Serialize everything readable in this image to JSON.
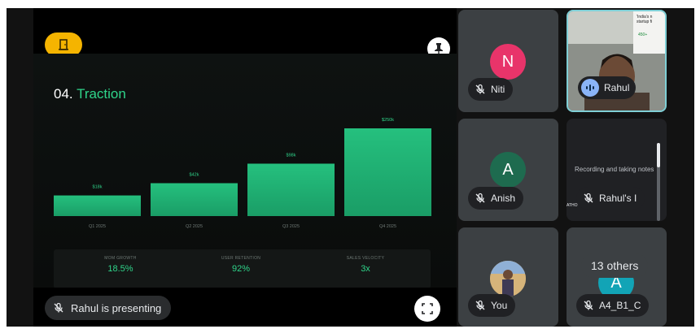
{
  "presentation": {
    "slide": {
      "number": "04.",
      "title": "Traction"
    },
    "presenting_label": "Rahul is presenting",
    "stats": [
      {
        "label": "MOM GROWTH",
        "value": "18.5%"
      },
      {
        "label": "USER RETENTION",
        "value": "92%"
      },
      {
        "label": "SALES VELOCITY",
        "value": "3x"
      }
    ]
  },
  "chart_data": {
    "type": "bar",
    "categories": [
      "Q1 2025",
      "Q2 2025",
      "Q3 2025",
      "Q4 2025"
    ],
    "values": [
      18,
      42,
      98,
      250
    ],
    "value_labels": [
      "$18k",
      "$42k",
      "$98k",
      "$250k"
    ],
    "bar_color": "#1a9d66",
    "bar_color_top": "#25c07e"
  },
  "participants": {
    "niti": {
      "initial": "N",
      "name": "Niti",
      "avatar_color": "#e8346a"
    },
    "rahul": {
      "name": "Rahul",
      "video_caption": "'India's n startup fi",
      "video_badge": "450+"
    },
    "anish": {
      "initial": "A",
      "name": "Anish",
      "avatar_color": "#1e6b4f"
    },
    "rahuls_share": {
      "name": "Rahul's I",
      "overlay_text": "Recording and taking notes",
      "footer_text": "ATHO"
    },
    "you": {
      "name": "You"
    },
    "a4": {
      "initial": "A",
      "name": "A4_B1_C",
      "avatar_color": "#12a4b6",
      "others_label": "13 others"
    }
  },
  "colors": {
    "accent_green": "#2fd48a",
    "door_button": "#f5b400",
    "tile_bg": "#3c4043"
  },
  "icons": {
    "door": "door-icon",
    "pin": "pin-icon",
    "fullscreen": "fullscreen-icon",
    "mic_off": "mic-off-icon",
    "speaking": "audio-wave-icon"
  }
}
